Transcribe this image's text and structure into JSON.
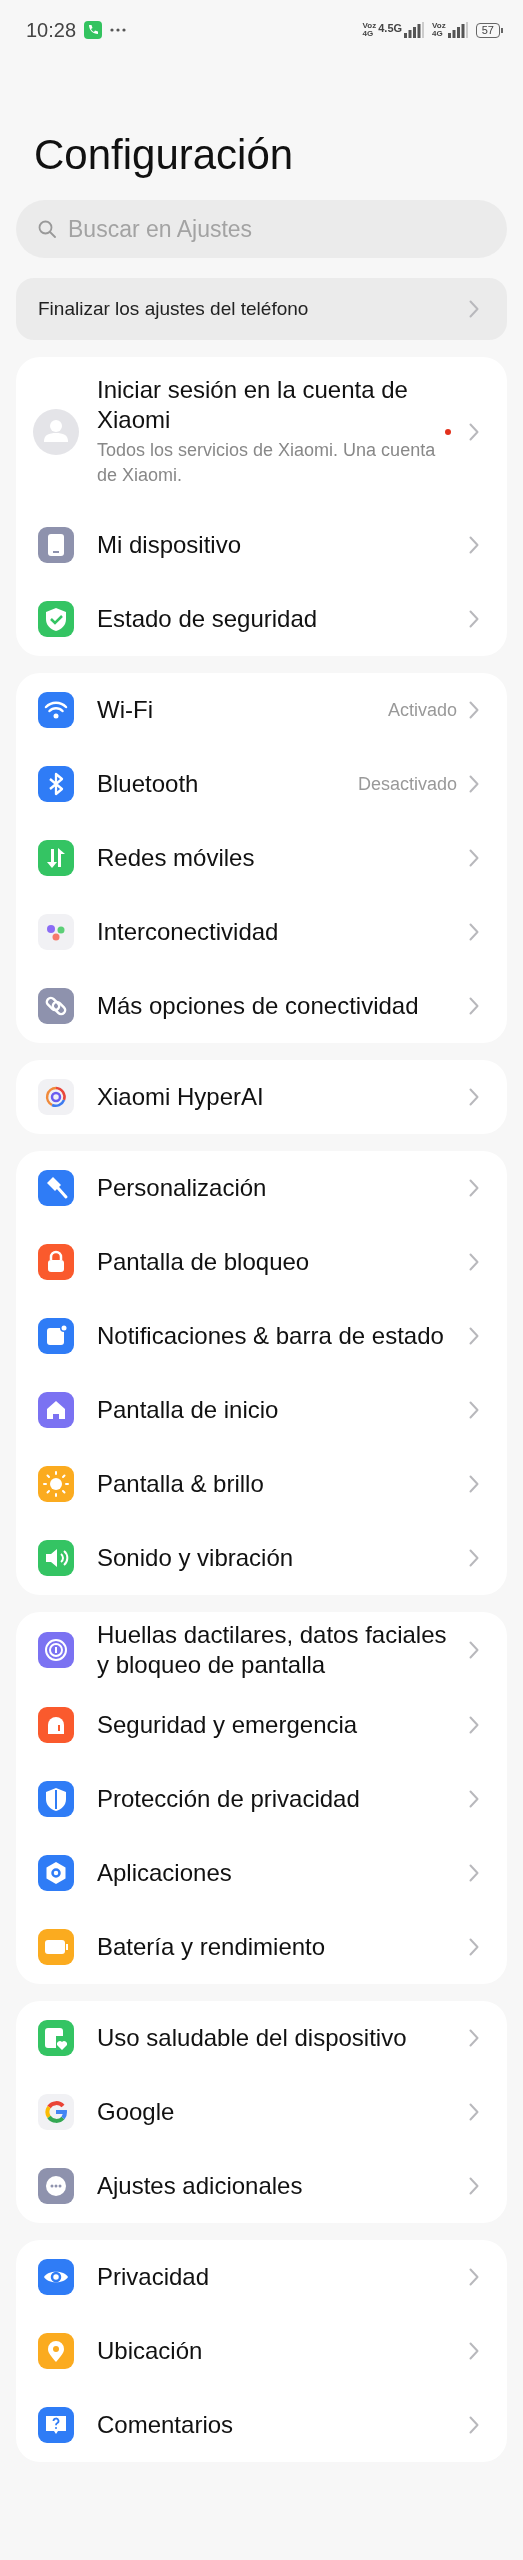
{
  "status_bar": {
    "time": "10:28",
    "networks": [
      {
        "top": "Voz",
        "bottom": "4G",
        "label": "4.5G"
      },
      {
        "top": "Voz",
        "bottom": "4G"
      }
    ],
    "battery": "57"
  },
  "title": "Configuración",
  "search": {
    "placeholder": "Buscar en Ajustes"
  },
  "setup_banner": {
    "label": "Finalizar los ajustes del teléfono"
  },
  "sections": [
    {
      "items": [
        {
          "kind": "account",
          "label": "Iniciar sesión en la cuenta de Xiaomi",
          "description": "Todos los servicios de Xiaomi. Una cuenta de Xiaomi.",
          "badge": true
        },
        {
          "kind": "item",
          "label": "Mi dispositivo",
          "badge": false
        },
        {
          "kind": "item",
          "label": "Estado de seguridad",
          "badge": false
        }
      ]
    },
    {
      "items": [
        {
          "kind": "item",
          "label": "Wi-Fi",
          "value": "Activado",
          "badge": false
        },
        {
          "kind": "item",
          "label": "Bluetooth",
          "value": "Desactivado",
          "badge": false
        },
        {
          "kind": "item",
          "label": "Redes móviles",
          "badge": false
        },
        {
          "kind": "item",
          "label": "Interconectividad",
          "badge": false
        },
        {
          "kind": "item",
          "label": "Más opciones de conectividad",
          "badge": false
        }
      ]
    },
    {
      "items": [
        {
          "kind": "item",
          "label": "Xiaomi HyperAI",
          "badge": false
        }
      ]
    },
    {
      "items": [
        {
          "kind": "item",
          "label": "Personalización",
          "badge": false
        },
        {
          "kind": "item",
          "label": "Pantalla de bloqueo",
          "badge": false
        },
        {
          "kind": "item",
          "label": "Notificaciones & barra de estado",
          "badge": false
        },
        {
          "kind": "item",
          "label": "Pantalla de inicio",
          "badge": false
        },
        {
          "kind": "item",
          "label": "Pantalla & brillo",
          "badge": false
        },
        {
          "kind": "item",
          "label": "Sonido y vibración",
          "badge": false
        }
      ]
    },
    {
      "items": [
        {
          "kind": "item",
          "label": "Huellas dactilares, datos faciales y bloqueo de pantalla",
          "badge": false
        },
        {
          "kind": "item",
          "label": "Seguridad y emergencia",
          "badge": false
        },
        {
          "kind": "item",
          "label": "Protección de privacidad",
          "badge": false
        },
        {
          "kind": "item",
          "label": "Aplicaciones",
          "badge": false
        },
        {
          "kind": "item",
          "label": "Batería y rendimiento",
          "badge": false
        }
      ]
    },
    {
      "items": [
        {
          "kind": "item",
          "label": "Uso saludable del dispositivo",
          "badge": false
        },
        {
          "kind": "item",
          "label": "Google",
          "badge": false
        },
        {
          "kind": "item",
          "label": "Ajustes adicionales",
          "badge": false
        }
      ]
    },
    {
      "items": [
        {
          "kind": "item",
          "label": "Privacidad",
          "badge": false
        },
        {
          "kind": "item",
          "label": "Ubicación",
          "badge": false
        },
        {
          "kind": "item",
          "label": "Comentarios",
          "badge": false
        }
      ]
    }
  ]
}
